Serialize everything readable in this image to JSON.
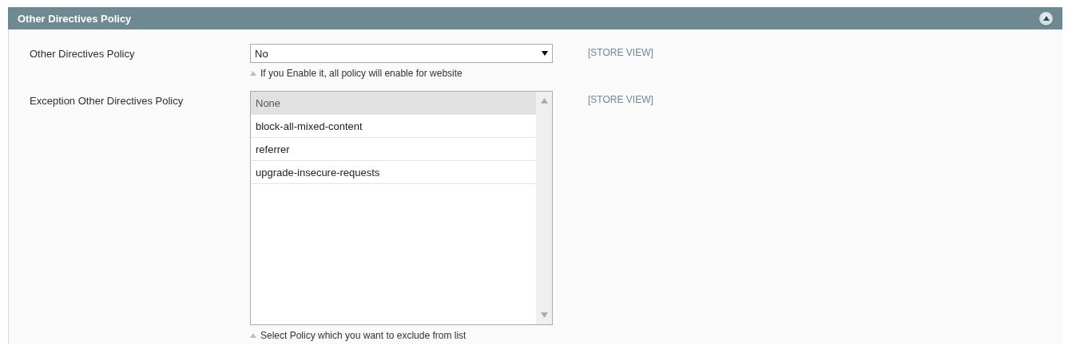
{
  "section": {
    "title": "Other Directives Policy",
    "expanded": true
  },
  "fields": [
    {
      "kind": "select",
      "label": "Other Directives Policy",
      "value": "No",
      "hint": "If you Enable it, all policy will enable for website",
      "scope": "[STORE VIEW]"
    },
    {
      "kind": "multiselect",
      "label": "Exception Other Directives Policy",
      "options": [
        {
          "label": "None",
          "selected": true
        },
        {
          "label": "block-all-mixed-content",
          "selected": false
        },
        {
          "label": "referrer",
          "selected": false
        },
        {
          "label": "upgrade-insecure-requests",
          "selected": false
        }
      ],
      "hint": "Select Policy which you want to exclude from list",
      "scope": "[STORE VIEW]"
    }
  ]
}
